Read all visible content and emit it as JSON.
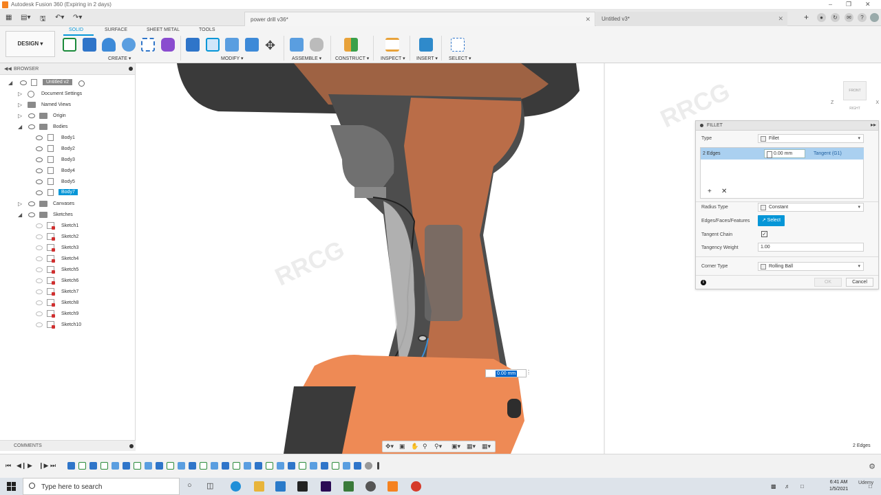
{
  "window": {
    "title": "Autodesk Fusion 360 (Expiring in 2 days)"
  },
  "tabs": [
    {
      "label": "power drill v36*"
    },
    {
      "label": "Untitled v3*"
    }
  ],
  "ribbon": {
    "workspace": "DESIGN",
    "tabs": [
      "SOLID",
      "SURFACE",
      "SHEET METAL",
      "TOOLS"
    ],
    "active_tab": "SOLID",
    "groups": [
      "CREATE ▾",
      "MODIFY ▾",
      "ASSEMBLE ▾",
      "CONSTRUCT ▾",
      "INSPECT ▾",
      "INSERT ▾",
      "SELECT ▾"
    ]
  },
  "browser": {
    "header": "BROWSER",
    "root": "Untitled v2",
    "items": {
      "document_settings": "Document Settings",
      "named_views": "Named Views",
      "origin": "Origin",
      "bodies": "Bodies",
      "canvases": "Canvases",
      "sketches": "Sketches"
    },
    "bodies": [
      "Body1",
      "Body2",
      "Body3",
      "Body4",
      "Body5",
      "Body7"
    ],
    "selected_body": "Body7",
    "sketches": [
      "Sketch1",
      "Sketch2",
      "Sketch3",
      "Sketch4",
      "Sketch5",
      "Sketch6",
      "Sketch7",
      "Sketch8",
      "Sketch9",
      "Sketch10"
    ]
  },
  "comments": {
    "header": "COMMENTS"
  },
  "viewcube": {
    "face_left": "FRONT",
    "face_right": "RIGHT",
    "axis_z": "Z",
    "axis_x": "X"
  },
  "viewport": {
    "dimension_value": "0.00 mm",
    "watermark": "RRCG"
  },
  "fillet": {
    "title": "FILLET",
    "type_label": "Type",
    "type_value": "Fillet",
    "edges_label": "2 Edges",
    "radius_value": "0.00 mm",
    "continuity": "Tangent (G1)",
    "add_glyph": "+",
    "remove_glyph": "✕",
    "radius_type_label": "Radius Type",
    "radius_type_value": "Constant",
    "edges_faces_label": "Edges/Faces/Features",
    "select_button": "Select",
    "tangent_chain_label": "Tangent Chain",
    "tangent_chain_checked": true,
    "tangency_weight_label": "Tangency Weight",
    "tangency_weight_value": "1.00",
    "corner_type_label": "Corner Type",
    "corner_type_value": "Rolling Ball",
    "ok_label": "OK",
    "cancel_label": "Cancel"
  },
  "status": {
    "selection": "2 Edges"
  },
  "taskbar": {
    "search_placeholder": "Type here to search",
    "time": "6:41 AM",
    "date": "1/5/2021",
    "overlay_brand": "Udemy"
  },
  "colors": {
    "accent": "#0696d7",
    "drill_dark": "#4a4a4a",
    "drill_orange": "#d9703a",
    "battery_orange": "#ee8a55"
  }
}
